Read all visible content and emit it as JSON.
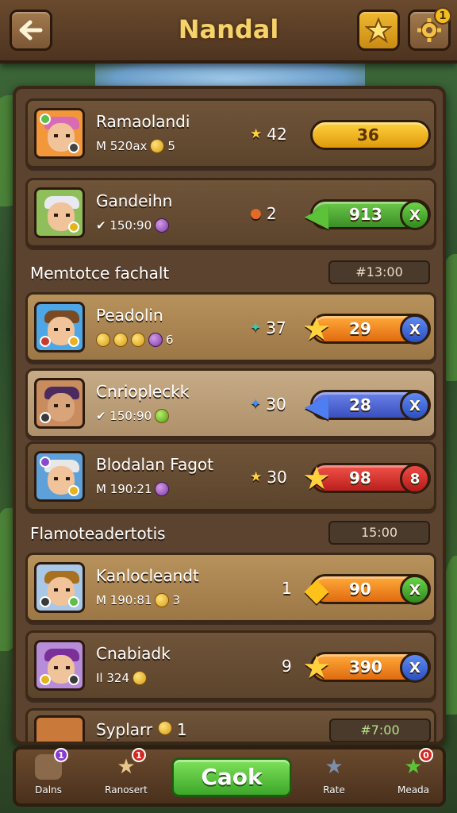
{
  "header": {
    "title": "Nandal",
    "gear_badge": "1"
  },
  "players_top": [
    {
      "name": "Ramaolandi",
      "sub_text": "M 520ax",
      "sub_value": "5",
      "score_symbol": "★",
      "score": "42",
      "pill_value": "36",
      "pill_color": "yellow",
      "end_icon": ""
    },
    {
      "name": "Gandeihn",
      "sub_text": "✔ 150:90",
      "sub_value": "",
      "score_symbol": "●",
      "score": "2",
      "pill_value": "913",
      "pill_color": "green",
      "end_icon": "X"
    }
  ],
  "section1": {
    "label": "Memtotce fachalt",
    "timer": "#13:00"
  },
  "players_mid": [
    {
      "name": "Peadolin",
      "sub_text": "",
      "sub_value": "6",
      "score_symbol": "✦",
      "score": "37",
      "pill_value": "29",
      "pill_color": "orange",
      "end_icon": "X"
    },
    {
      "name": "Cnriopleckk",
      "sub_text": "✔ 150:90",
      "sub_value": "",
      "score_symbol": "✦",
      "score": "30",
      "pill_value": "28",
      "pill_color": "blue",
      "end_icon": "X"
    },
    {
      "name": "Blodalan Fagot",
      "sub_text": "M 190:21",
      "sub_value": "",
      "score_symbol": "★",
      "score": "30",
      "pill_value": "98",
      "pill_color": "red",
      "end_icon": "8"
    }
  ],
  "section2": {
    "label": "Flamoteadertotis",
    "timer": "15:00"
  },
  "players_bottom": [
    {
      "name": "Kanlocleandt",
      "sub_text": "M 190:81",
      "sub_value": "3",
      "score_symbol": "",
      "score": "1",
      "pill_value": "90",
      "pill_color": "orange",
      "end_icon": "X"
    },
    {
      "name": "Cnabiadk",
      "sub_text": "Il 324",
      "sub_value": "",
      "score_symbol": "",
      "score": "9",
      "pill_value": "390",
      "pill_color": "orange",
      "end_icon": "X"
    }
  ],
  "partial_row": {
    "name": "Syplarr",
    "value": "1",
    "timer": "#7:00"
  },
  "bottom_nav": {
    "items": [
      {
        "label": "Dalns",
        "badge": "1"
      },
      {
        "label": "Ranosert",
        "badge": "1"
      },
      {
        "label": "Rate",
        "badge": ""
      },
      {
        "label": "Meada",
        "badge": "0"
      }
    ],
    "cta_label": "Caok"
  },
  "colors": {
    "accent_gold": "#f6d36a",
    "cta_green": "#3ea72a"
  }
}
